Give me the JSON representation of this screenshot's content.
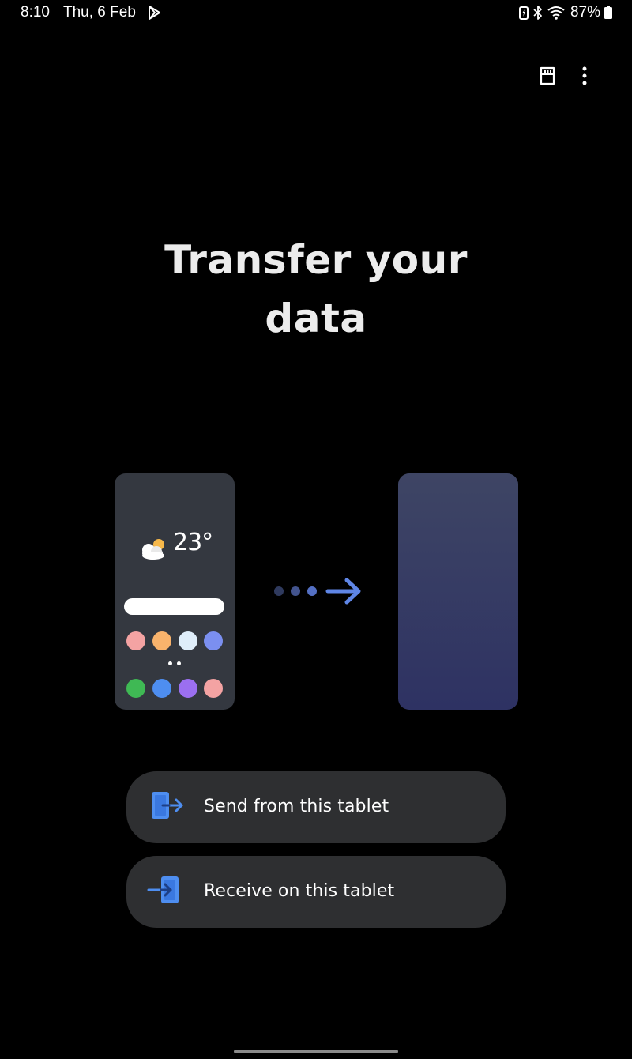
{
  "status_bar": {
    "time": "8:10",
    "date": "Thu, 6 Feb",
    "battery_percent": "87%"
  },
  "header": {
    "actions": [
      {
        "icon": "sd-card-icon"
      },
      {
        "icon": "more-vert-icon"
      }
    ]
  },
  "main": {
    "title_line1": "Transfer your",
    "title_line2": "data"
  },
  "illustration": {
    "source_phone": {
      "temperature": "23°",
      "app_colors_row1": [
        "#f4a3a3",
        "#f9b36c",
        "#dfeefa",
        "#7b8ff0"
      ],
      "app_colors_row2": [
        "#3fb954",
        "#4e8ef0",
        "#9b6ff0",
        "#f4a3a3"
      ]
    },
    "arrow_color": "#5f86e6"
  },
  "actions": {
    "send_label": "Send from this tablet",
    "receive_label": "Receive on this tablet"
  },
  "colors": {
    "background": "#000000",
    "button_bg": "#2e2f31",
    "accent": "#4e8ef0",
    "title": "#ececec"
  }
}
